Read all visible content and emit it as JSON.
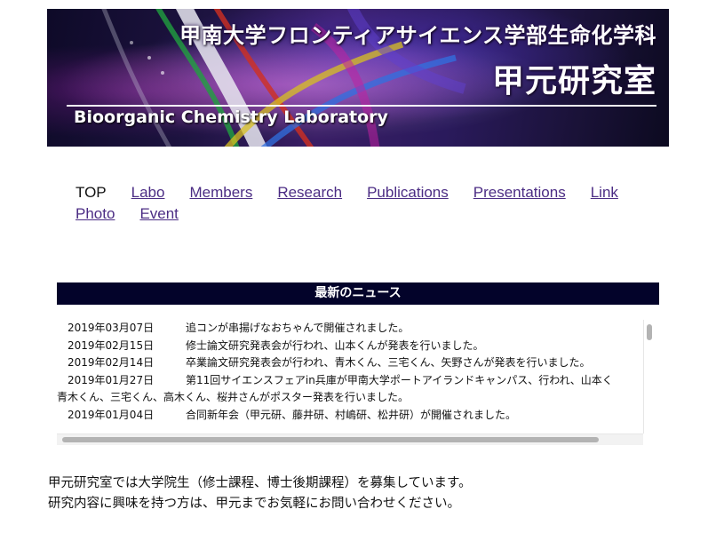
{
  "banner": {
    "faculty_title": "甲南大学フロンティアサイエンス学部生命化学科",
    "lab_name_jp": "甲元研究室",
    "lab_name_en": "Bioorganic Chemistry Laboratory"
  },
  "nav": {
    "row1": [
      {
        "label": "TOP",
        "current": true
      },
      {
        "label": "Labo",
        "current": false
      },
      {
        "label": "Members",
        "current": false
      },
      {
        "label": "Research",
        "current": false
      },
      {
        "label": "Publications",
        "current": false
      },
      {
        "label": "Presentations",
        "current": false
      },
      {
        "label": "Link",
        "current": false
      }
    ],
    "row2": [
      {
        "label": "Photo",
        "current": false
      },
      {
        "label": "Event",
        "current": false
      }
    ]
  },
  "news": {
    "header": "最新のニュース",
    "items": [
      {
        "date": "2019年03月07日",
        "text": "追コンが串揚げなおちゃんで開催されました。"
      },
      {
        "date": "2019年02月15日",
        "text": "修士論文研究発表会が行われ、山本くんが発表を行いました。"
      },
      {
        "date": "2019年02月14日",
        "text": "卒業論文研究発表会が行われ、青木くん、三宅くん、矢野さんが発表を行いました。"
      },
      {
        "date": "2019年01月27日",
        "text": "第11回サイエンスフェアin兵庫が甲南大学ポートアイランドキャンパス、行われ、山本く",
        "continuation": "青木くん、三宅くん、高木くん、桜井さんがポスター発表を行いました。"
      },
      {
        "date": "2019年01月04日",
        "text": "合同新年会（甲元研、藤井研、村嶋研、松井研）が開催されました。"
      }
    ]
  },
  "recruit": {
    "line1": "甲元研究室では大学院生（修士課程、博士後期課程）を募集しています。",
    "line2": "研究内容に興味を持つ方は、甲元までお気軽にお問い合わせください。"
  },
  "colors": {
    "link": "#4b2c84",
    "news_header_bg": "#03032a",
    "banner_bg": "#1d1340"
  }
}
